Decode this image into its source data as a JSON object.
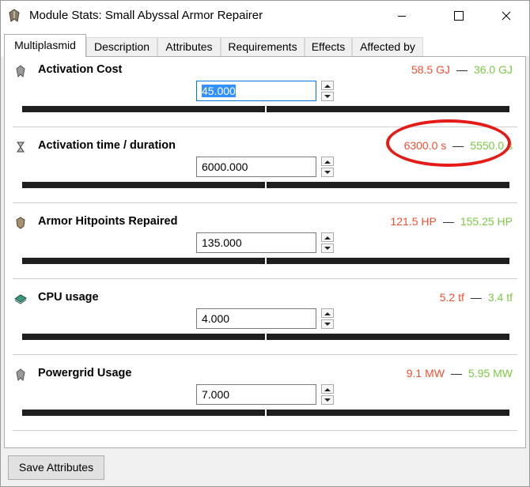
{
  "window": {
    "title": "Module Stats: Small Abyssal Armor Repairer",
    "app_icon": "armor-repairer-icon"
  },
  "tabs": [
    {
      "label": "Multiplasmid",
      "active": true
    },
    {
      "label": "Description",
      "active": false
    },
    {
      "label": "Attributes",
      "active": false
    },
    {
      "label": "Requirements",
      "active": false
    },
    {
      "label": "Effects",
      "active": false
    },
    {
      "label": "Affected by",
      "active": false
    }
  ],
  "stats": [
    {
      "label": "Activation Cost",
      "icon": "capacitor-icon",
      "value": "45.000",
      "min": "58.5 GJ",
      "max": "36.0 GJ",
      "slider_fraction": 0.5
    },
    {
      "label": "Activation time / duration",
      "icon": "hourglass-icon",
      "value": "6000.000",
      "min": "6300.0 s",
      "max": "5550.0 s",
      "slider_fraction": 0.5
    },
    {
      "label": "Armor Hitpoints Repaired",
      "icon": "armor-repair-icon",
      "value": "135.000",
      "min": "121.5 HP",
      "max": "155.25 HP",
      "slider_fraction": 0.5
    },
    {
      "label": "CPU usage",
      "icon": "cpu-icon",
      "value": "4.000",
      "min": "5.2 tf",
      "max": "3.4 tf",
      "slider_fraction": 0.5
    },
    {
      "label": "Powergrid Usage",
      "icon": "powergrid-icon",
      "value": "7.000",
      "min": "9.1 MW",
      "max": "5.95 MW",
      "slider_fraction": 0.5
    }
  ],
  "range_separator": "—",
  "footer": {
    "save_label": "Save Attributes"
  },
  "colors": {
    "bad": "#f05032",
    "good": "#7ac943",
    "annotation": "#e41b17"
  }
}
